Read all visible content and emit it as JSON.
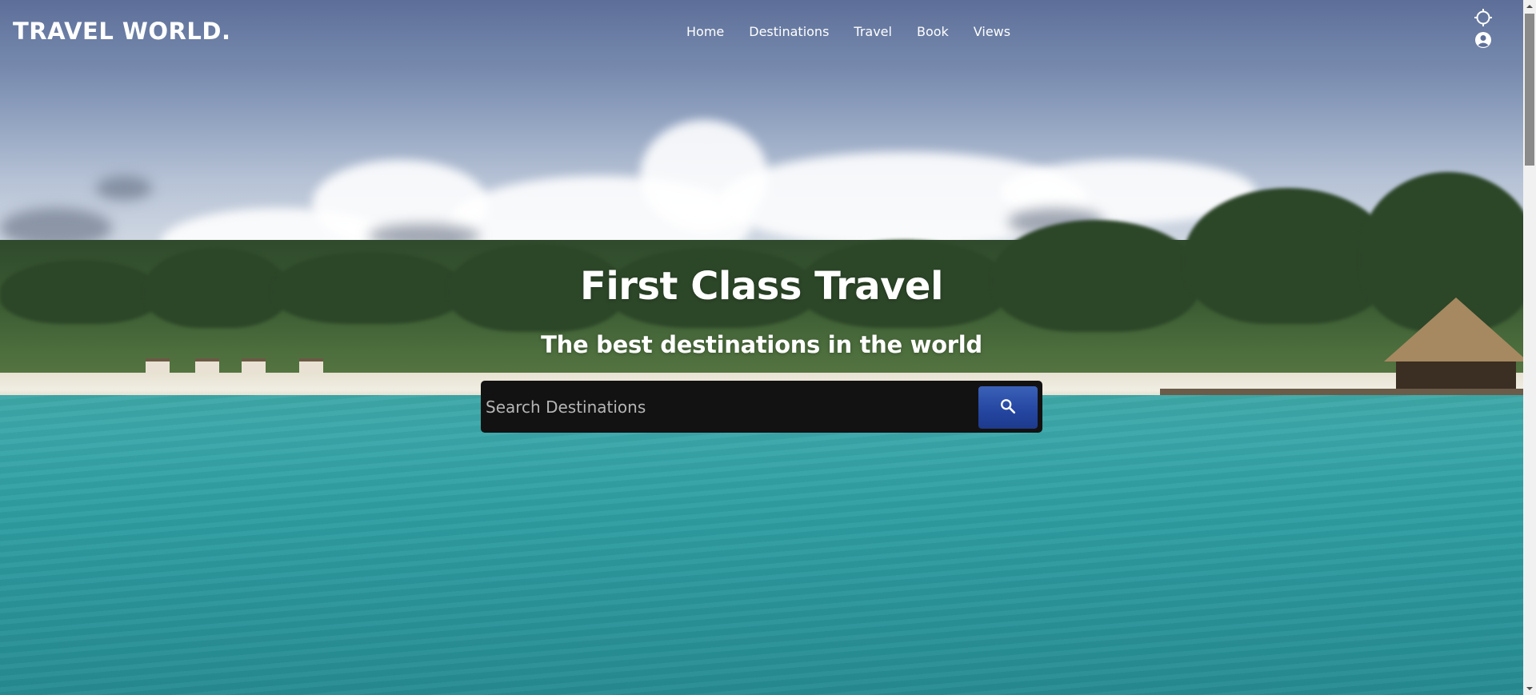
{
  "brand": {
    "logo_text": "TRAVEL WORLD."
  },
  "nav": {
    "items": [
      {
        "label": "Home"
      },
      {
        "label": "Destinations"
      },
      {
        "label": "Travel"
      },
      {
        "label": "Book"
      },
      {
        "label": "Views"
      }
    ],
    "icons": [
      "crosshair-icon",
      "user-circle-icon"
    ]
  },
  "hero": {
    "title": "First Class Travel",
    "subtitle": "The best destinations in the world",
    "background": "tropical-beach-scene"
  },
  "search": {
    "placeholder": "Search Destinations",
    "value": "",
    "button_icon": "search-icon"
  },
  "colors": {
    "search_bar_bg": "#131212",
    "search_button": "#2445a0",
    "text": "#ffffff"
  }
}
